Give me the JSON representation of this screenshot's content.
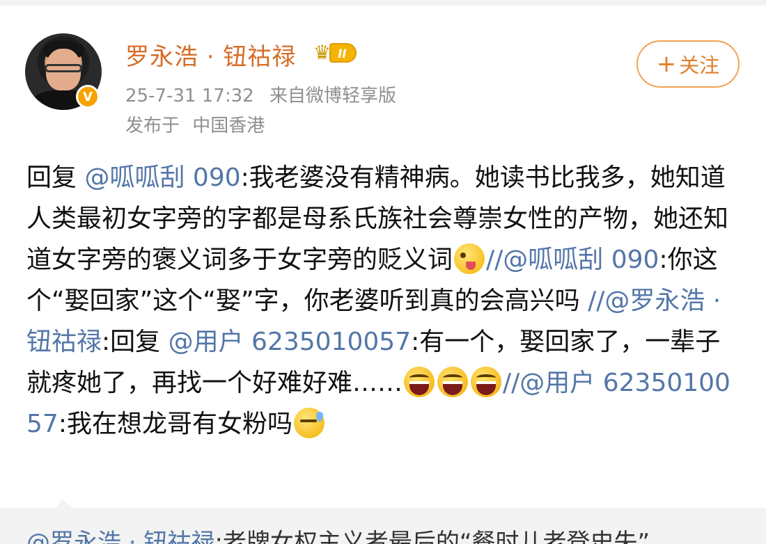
{
  "header": {
    "username": "罗永浩 · 钮祜禄",
    "member_level": "II",
    "verified_mark": "V",
    "timestamp": "25-7-31 17:32",
    "source": "来自微博轻享版",
    "location_prefix": "发布于",
    "location": "中国香港",
    "follow_plus": "+",
    "follow_label": "关注"
  },
  "post": {
    "p1": "回复",
    "m1": "@呱呱刮 090",
    "p2": ":我老婆没有精神病。她读书比我多，她知道人类最初女字旁的字都是母系氏族社会尊崇女性的产物，她还知道女字旁的褒义词多于女字旁的贬义词",
    "s1": "//",
    "m2": "@呱呱刮 090",
    "p3": ":你这个“娶回家”这个“娶”字，你老婆听到真的会高兴吗",
    "s2": "//",
    "m3": "@罗永浩 · 钮祜禄",
    "p4": ":回复",
    "m4": "@用户 6235010057",
    "p5": ":有一个，娶回家了，一辈子就疼她了，再找一个好难好难……",
    "s3": "//",
    "m5": "@用户 6235010057",
    "p6": ":我在想龙哥有女粉吗"
  },
  "repost": {
    "mention": "@罗永浩 · 钮祜禄",
    "text": ":老牌女权主义者最后的“餐时儿老登史失”"
  },
  "icons": {
    "avatar": "avatar-photo",
    "verified": "verified-v-icon",
    "member": "crown-icon",
    "emoji_1": "tongue-out-emoji",
    "emoji_2": "laughing-emoji",
    "emoji_3": "sweat-smile-emoji"
  },
  "colors": {
    "username": "#d56d27",
    "mention": "#5376a8",
    "meta": "#8f8f8f",
    "follow_border": "#f0a24c",
    "verified": "#f7a400"
  }
}
